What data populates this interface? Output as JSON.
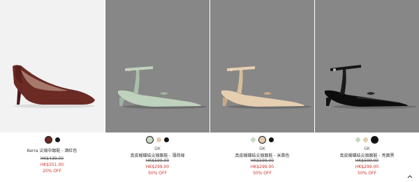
{
  "products": [
    {
      "brand": "",
      "name": "Kerra 尖頭中跟鞋 - 酒紅色",
      "original_price": "HK$439.00",
      "sale_price": "HK$351.00",
      "discount": "20% OFF",
      "swatches": [
        {
          "color": "#6b2a24",
          "selected": true
        },
        {
          "color": "#1a1a1a",
          "selected": false
        }
      ],
      "background": "#f2f2f2"
    },
    {
      "brand": "GK",
      "name": "真皮蝴蝶結尖頭跟鞋 - 薄荷綠",
      "original_price": "HK$599.00",
      "sale_price": "HK$299.00",
      "discount": "50% OFF",
      "swatches": [
        {
          "color": "#c9d9c6",
          "selected": true
        },
        {
          "color": "#e3cdb0",
          "selected": false
        },
        {
          "color": "#111111",
          "selected": false
        }
      ],
      "background": "#878787"
    },
    {
      "brand": "GK",
      "name": "真皮蝴蝶結尖頭跟鞋 - 米黃色",
      "original_price": "HK$599.00",
      "sale_price": "HK$299.00",
      "discount": "50% OFF",
      "swatches": [
        {
          "color": "#c9d9c6",
          "selected": false
        },
        {
          "color": "#e3cdb0",
          "selected": true
        },
        {
          "color": "#111111",
          "selected": false
        }
      ],
      "background": "#878787"
    },
    {
      "brand": "GK",
      "name": "真皮蝴蝶結尖頭跟鞋 - 亮面黑",
      "original_price": "HK$599.00",
      "sale_price": "HK$299.00",
      "discount": "50% OFF",
      "swatches": [
        {
          "color": "#c9d9c6",
          "selected": false
        },
        {
          "color": "#e3cdb0",
          "selected": false
        },
        {
          "color": "#111111",
          "selected": true
        }
      ],
      "background": "#878787"
    }
  ],
  "icons": {
    "scroll_top": "chevron-up-icon"
  }
}
